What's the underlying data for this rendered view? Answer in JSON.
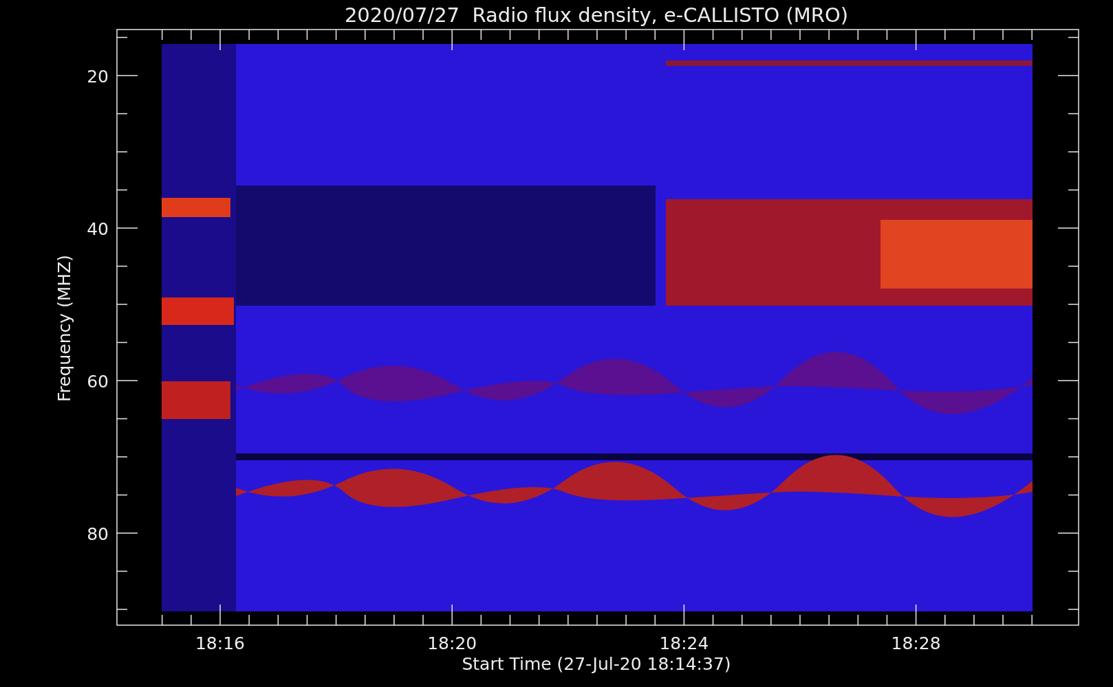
{
  "plot": {
    "title": "2020/07/27  Radio flux density, e-CALLISTO (MRO)",
    "xlabel": "Start Time (27-Jul-20 18:14:37)",
    "ylabel": "Frequency (MHZ)",
    "xtick_labels": [
      "18:16",
      "18:20",
      "18:24",
      "18:28"
    ],
    "ytick_labels": [
      "20",
      "40",
      "60",
      "80"
    ]
  }
}
